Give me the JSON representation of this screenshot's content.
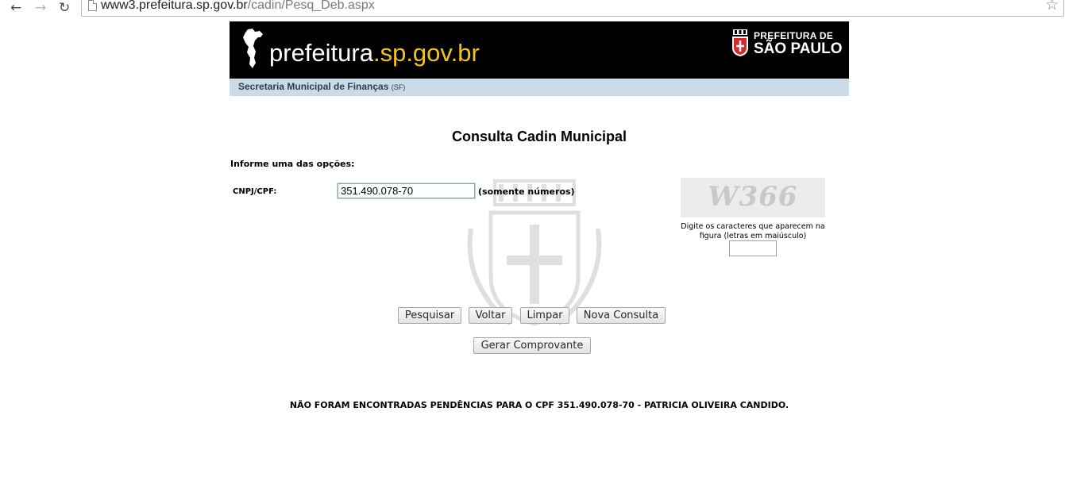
{
  "browser": {
    "url_host": "www3.prefeitura.sp.gov.br",
    "url_path": "/cadin/Pesq_Deb.aspx",
    "icons": {
      "back": "back-arrow-icon",
      "forward": "forward-arrow-icon",
      "reload": "reload-icon",
      "page": "page-icon",
      "bookmark": "star-icon"
    }
  },
  "header": {
    "brand_white": "prefeitura",
    "brand_yellow": ".sp.gov.br",
    "city_line1": "PREFEITURA DE",
    "city_line2": "SÃO PAULO",
    "department": "Secretaria Municipal de Finanças",
    "department_abbr": "(SF)",
    "colors": {
      "banner_bg": "#000000",
      "brand_accent": "#f2c418",
      "subbar_bg": "#c9dbe6"
    }
  },
  "form": {
    "title": "Consulta Cadin Municipal",
    "instruction": "Informe uma das opções:",
    "cnpj_label": "CNPJ/CPF:",
    "cnpj_value": "351.490.078-70",
    "cnpj_hint": "(somente números)",
    "captcha_image_text": "W366",
    "captcha_help": "Digite os caracteres que aparecem na figura (letras em maiúsculo)",
    "captcha_value": ""
  },
  "buttons": {
    "pesquisar": "Pesquisar",
    "voltar": "Voltar",
    "limpar": "Limpar",
    "nova_consulta": "Nova Consulta",
    "gerar_comprovante": "Gerar Comprovante"
  },
  "result": {
    "message": "NÃO FORAM ENCONTRADAS PENDÊNCIAS PARA O CPF 351.490.078-70 - PATRICIA OLIVEIRA CANDIDO."
  }
}
